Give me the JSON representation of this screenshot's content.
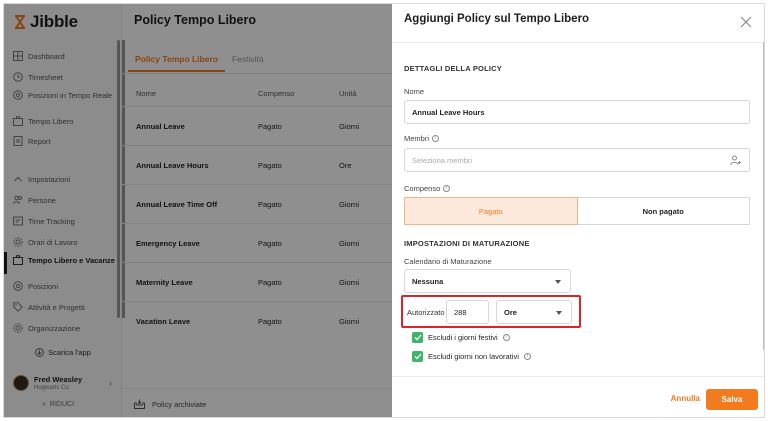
{
  "app": {
    "brand": "Jibble"
  },
  "sidebar": {
    "items": [
      {
        "label": "Dashboard",
        "icon": "dashboard-icon"
      },
      {
        "label": "Timesheet",
        "icon": "clock-icon"
      },
      {
        "label": "Posizioni in Tempo Reale",
        "icon": "location-icon"
      },
      {
        "label": "Tempo Libero",
        "icon": "suitcase-icon"
      },
      {
        "label": "Report",
        "icon": "report-icon"
      },
      {
        "label": "Impostazioni",
        "icon": "chevron-up-icon"
      },
      {
        "label": "Persone",
        "icon": "people-icon"
      },
      {
        "label": "Time Tracking",
        "icon": "time-tracking-icon"
      },
      {
        "label": "Orari di Lavoro",
        "icon": "gear-icon"
      },
      {
        "label": "Tempo Libero e Vacanze",
        "icon": "suitcase-icon"
      },
      {
        "label": "Posizioni",
        "icon": "location-icon"
      },
      {
        "label": "Attività e Progetti",
        "icon": "tag-icon"
      },
      {
        "label": "Organizzazione",
        "icon": "gear-icon"
      }
    ],
    "download_label": "Scarica l'app",
    "user": {
      "name": "Fred Weasley",
      "org": "Hogwarts Co"
    },
    "collapse_label": "RIDUCI"
  },
  "main": {
    "title": "Policy Tempo Libero",
    "tabs": [
      "Policy Tempo Libero",
      "Festività"
    ],
    "columns": [
      "Nome",
      "Compenso",
      "Unità"
    ],
    "rows": [
      {
        "name": "Annual Leave",
        "comp": "Pagato",
        "unit": "Giorni"
      },
      {
        "name": "Annual Leave Hours",
        "comp": "Pagato",
        "unit": "Ore"
      },
      {
        "name": "Annual Leave Time Off",
        "comp": "Pagato",
        "unit": "Giorni"
      },
      {
        "name": "Emergency Leave",
        "comp": "Pagato",
        "unit": "Giorni"
      },
      {
        "name": "Maternity Leave",
        "comp": "Pagato",
        "unit": "Giorni"
      },
      {
        "name": "Vacation Leave",
        "comp": "Pagato",
        "unit": "Giorni"
      }
    ],
    "archive_label": "Policy archiviate"
  },
  "panel": {
    "title": "Aggiungi Policy sul Tempo Libero",
    "section_details": "DETTAGLI DELLA POLICY",
    "name_label": "Nome",
    "name_value": "Annual Leave Hours",
    "members_label": "Membri",
    "members_placeholder": "Seleziona membri",
    "comp_label": "Compenso",
    "comp_options": [
      "Pagato",
      "Non pagato"
    ],
    "section_accrual": "IMPOSTAZIONI DI MATURAZIONE",
    "calendar_label": "Calendario di Maturazione",
    "calendar_value": "Nessuna",
    "authorized_label": "Autorizzato",
    "authorized_value": "288",
    "authorized_unit": "Ore",
    "check_holidays": "Escludi i giorni festivi",
    "check_nonworking": "Escludi giorni non lavorativi",
    "cancel_label": "Annulla",
    "save_label": "Salva"
  },
  "colors": {
    "accent": "#f27b1f",
    "check": "#3eb56b",
    "highlight": "#d9262b"
  }
}
